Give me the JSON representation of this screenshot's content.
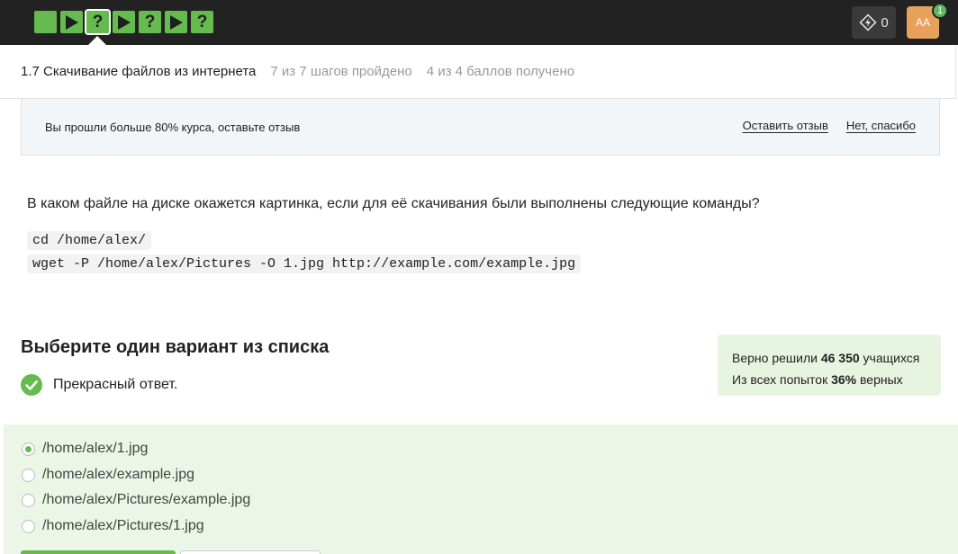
{
  "topbar": {
    "steps": [
      {
        "type": "text",
        "current": false
      },
      {
        "type": "video",
        "current": false
      },
      {
        "type": "quiz",
        "current": true
      },
      {
        "type": "video",
        "current": false
      },
      {
        "type": "quiz",
        "current": false
      },
      {
        "type": "video",
        "current": false
      },
      {
        "type": "quiz",
        "current": false
      }
    ],
    "quiz_glyph": "?",
    "energy_count": "0",
    "avatar_initials": "AA",
    "notification_count": "1"
  },
  "lesson": {
    "title": "1.7 Скачивание файлов из интернета",
    "steps_progress": "7 из 7 шагов пройдено",
    "score": "4 из 4 баллов  получено"
  },
  "review": {
    "message": "Вы прошли больше 80% курса, оставьте отзыв",
    "leave_review": "Оставить отзыв",
    "no_thanks": "Нет, спасибо"
  },
  "question": {
    "text": "В каком файле на диске окажется картинка, если для её скачивания были выполнены следующие команды?",
    "code_line_1": "cd /home/alex/",
    "code_line_2": "wget -P /home/alex/Pictures -O 1.jpg http://example.com/example.jpg"
  },
  "answer": {
    "heading": "Выберите один вариант из списка",
    "feedback": "Прекрасный ответ.",
    "options": [
      {
        "label": "/home/alex/1.jpg",
        "checked": true
      },
      {
        "label": "/home/alex/example.jpg",
        "checked": false
      },
      {
        "label": "/home/alex/Pictures/example.jpg",
        "checked": false
      },
      {
        "label": "/home/alex/Pictures/1.jpg",
        "checked": false
      }
    ]
  },
  "stats": {
    "solved_prefix": "Верно решили ",
    "solved_count": "46 350",
    "solved_suffix": " учащихся",
    "attempts_prefix": "Из всех попыток ",
    "attempts_percent": "36%",
    "attempts_suffix": " верных"
  },
  "colors": {
    "accent_green": "#66bb4f",
    "topbar_bg": "#222222",
    "options_bg": "#ebf6e6",
    "stats_bg": "#e6f4e0"
  }
}
